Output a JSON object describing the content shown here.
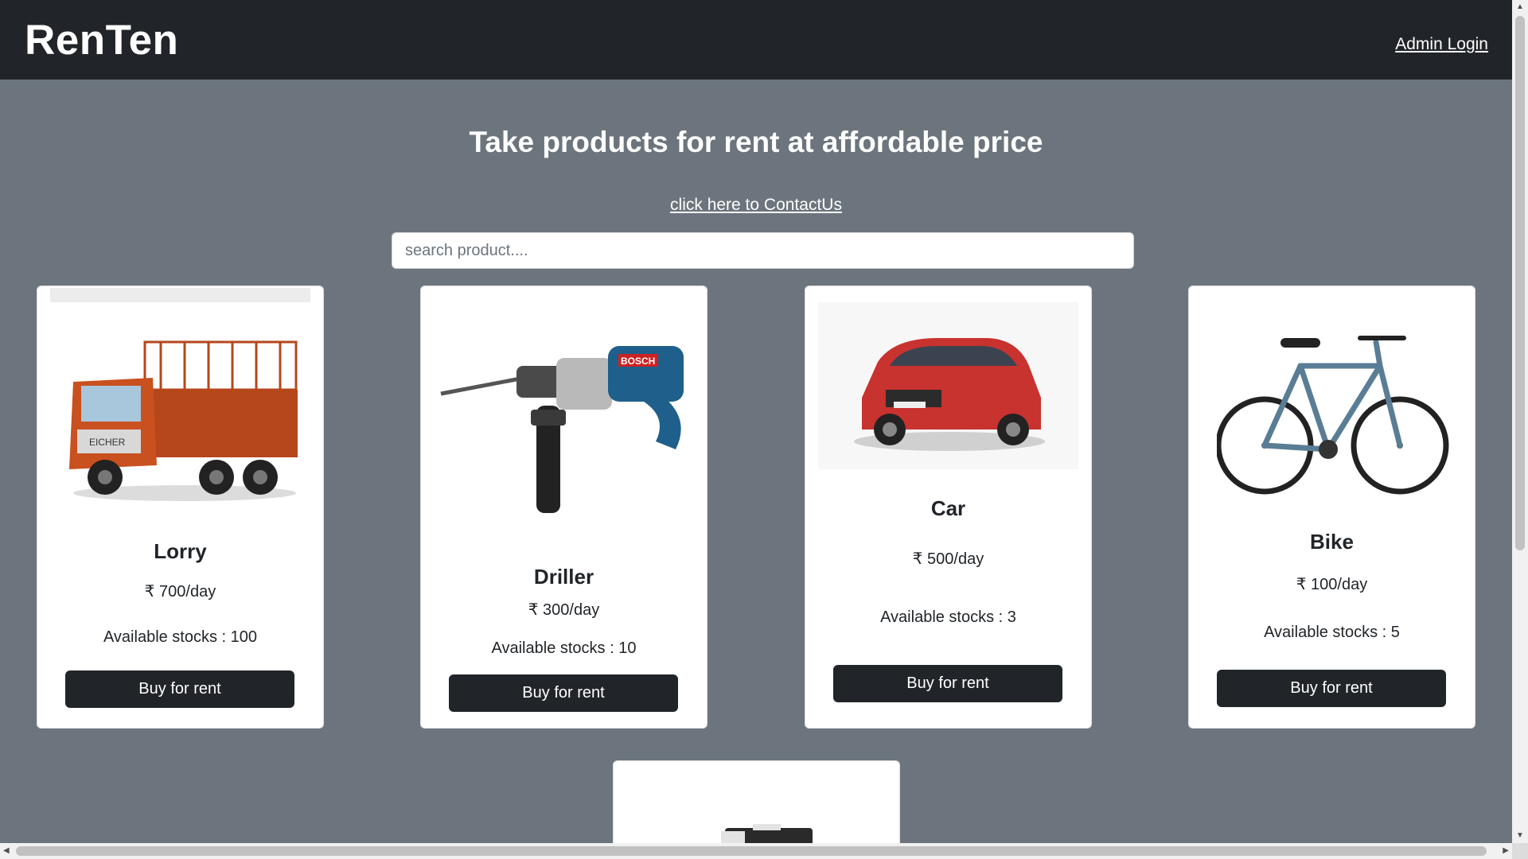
{
  "app": {
    "brand": "RenTen",
    "admin_login": "Admin Login"
  },
  "hero": {
    "headline": "Take products for rent at affordable price",
    "contact_link": "click here to ContactUs"
  },
  "search": {
    "placeholder": "search product....",
    "value": ""
  },
  "products": [
    {
      "name": "Lorry",
      "price": "₹ 700/day",
      "stock": "Available stocks : 100",
      "button": "Buy for rent",
      "icon": "lorry-image"
    },
    {
      "name": "Driller",
      "price": "₹ 300/day",
      "stock": "Available stocks : 10",
      "button": "Buy for rent",
      "icon": "drill-image"
    },
    {
      "name": "Car",
      "price": "₹ 500/day",
      "stock": "Available stocks : 3",
      "button": "Buy for rent",
      "icon": "car-image"
    },
    {
      "name": "Bike",
      "price": "₹ 100/day",
      "stock": "Available stocks : 5",
      "button": "Buy for rent",
      "icon": "bicycle-image"
    }
  ],
  "colors": {
    "navbar": "#212529",
    "page_bg": "#6c757d",
    "button": "#212529"
  }
}
